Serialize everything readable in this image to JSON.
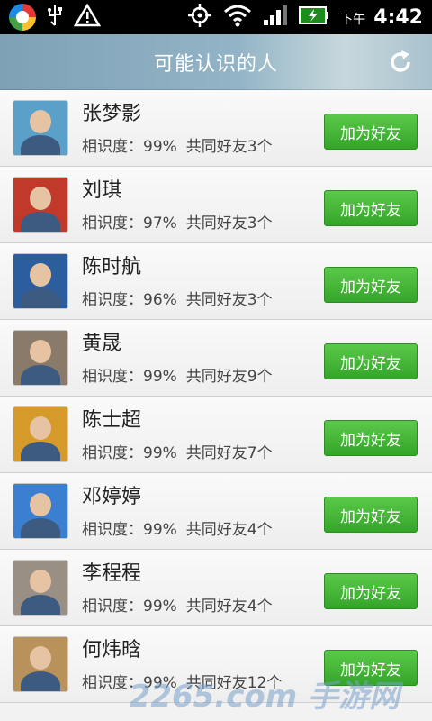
{
  "status_bar": {
    "ampm": "下午",
    "time": "4:42",
    "icons": [
      "app-launcher-icon",
      "usb-icon",
      "warning-icon",
      "gps-icon",
      "wifi-icon",
      "signal-icon",
      "battery-icon"
    ]
  },
  "header": {
    "title": "可能认识的人",
    "refresh_icon": "refresh-icon"
  },
  "people": [
    {
      "name": "张梦影",
      "familiarity": "相识度：99%",
      "mutual": "共同好友3个",
      "button": "加为好友",
      "tone": "#5aa0c8"
    },
    {
      "name": "刘琪",
      "familiarity": "相识度：97%",
      "mutual": "共同好友3个",
      "button": "加为好友",
      "tone": "#c0392b"
    },
    {
      "name": "陈时航",
      "familiarity": "相识度：96%",
      "mutual": "共同好友3个",
      "button": "加为好友",
      "tone": "#2c5e9e"
    },
    {
      "name": "黄晟",
      "familiarity": "相识度：99%",
      "mutual": "共同好友9个",
      "button": "加为好友",
      "tone": "#8a7a6a"
    },
    {
      "name": "陈士超",
      "familiarity": "相识度：99%",
      "mutual": "共同好友7个",
      "button": "加为好友",
      "tone": "#d59a2a"
    },
    {
      "name": "邓婷婷",
      "familiarity": "相识度：99%",
      "mutual": "共同好友4个",
      "button": "加为好友",
      "tone": "#3a7fd0"
    },
    {
      "name": "李程程",
      "familiarity": "相识度：99%",
      "mutual": "共同好友4个",
      "button": "加为好友",
      "tone": "#9a8f84"
    },
    {
      "name": "何炜晗",
      "familiarity": "相识度：99%",
      "mutual": "共同好友12个",
      "button": "加为好友",
      "tone": "#b8925a"
    }
  ],
  "watermark": "2265.com 手游网",
  "colors": {
    "button_green": "#35a52a",
    "header_blue": "#93b4c6"
  }
}
